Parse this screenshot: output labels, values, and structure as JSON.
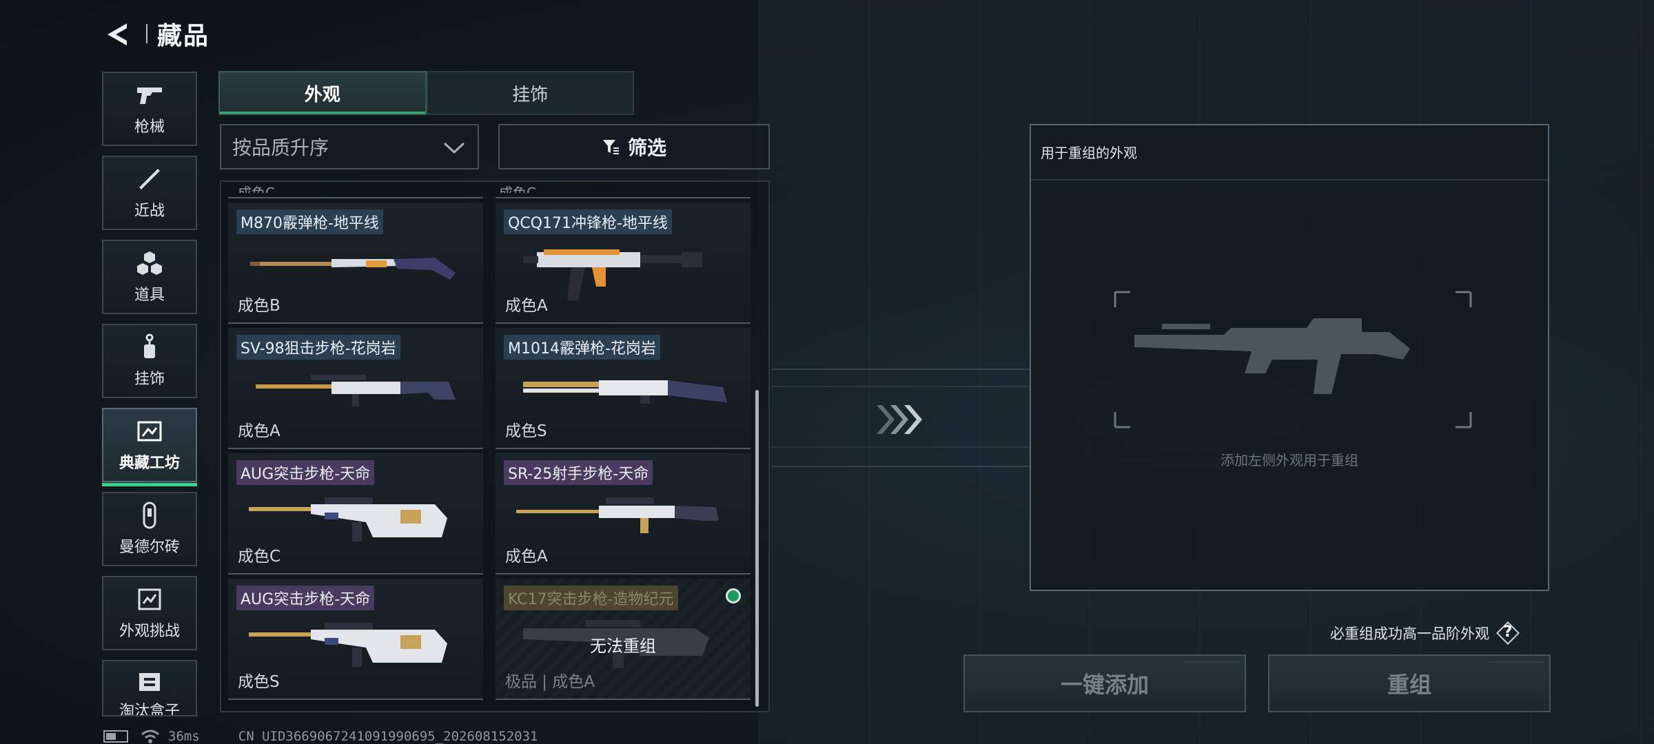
{
  "header": {
    "title": "藏品"
  },
  "nav": [
    {
      "label": "枪械",
      "icon": "pistol-icon"
    },
    {
      "label": "近战",
      "icon": "knife-icon"
    },
    {
      "label": "道具",
      "icon": "cubes-icon"
    },
    {
      "label": "挂饰",
      "icon": "charm-icon"
    },
    {
      "label": "典藏工坊",
      "icon": "workshop-icon",
      "active": true
    },
    {
      "label": "曼德尔砖",
      "icon": "brick-icon"
    },
    {
      "label": "外观挑战",
      "icon": "challenge-icon"
    },
    {
      "label": "淘汰盒子",
      "icon": "box-icon"
    }
  ],
  "tabs": [
    {
      "label": "外观",
      "active": true
    },
    {
      "label": "挂饰",
      "active": false
    }
  ],
  "sort": {
    "value": "按品质升序"
  },
  "filter": {
    "label": "筛选"
  },
  "cutoff_row": [
    "成色C",
    "成色C"
  ],
  "items": [
    {
      "name": "M870霰弹枪-地平线",
      "grade": "成色B",
      "tag": "blue"
    },
    {
      "name": "QCQ171冲锋枪-地平线",
      "grade": "成色A",
      "tag": "blue"
    },
    {
      "name": "SV-98狙击步枪-花岗岩",
      "grade": "成色A",
      "tag": "blue"
    },
    {
      "name": "M1014霰弹枪-花岗岩",
      "grade": "成色S",
      "tag": "blue"
    },
    {
      "name": "AUG突击步枪-天命",
      "grade": "成色C",
      "tag": "purple"
    },
    {
      "name": "SR-25射手步枪-天命",
      "grade": "成色A",
      "tag": "purple"
    },
    {
      "name": "AUG突击步枪-天命",
      "grade": "成色S",
      "tag": "purple"
    },
    {
      "name": "KC17突击步枪-造物纪元",
      "grade": "极品 | 成色A",
      "tag": "gold",
      "disabled": true,
      "overlay": "无法重组"
    }
  ],
  "panel": {
    "title": "用于重组的外观",
    "hint": "添加左侧外观用于重组"
  },
  "help": {
    "text": "必重组成功高一品阶外观",
    "icon": "question-icon"
  },
  "buttons": {
    "add_all": "一键添加",
    "regroup": "重组"
  },
  "status": {
    "ping": "36ms",
    "uid": "CN UID3669067241091990695_202608152031"
  },
  "colors": {
    "accent": "#39d28a",
    "background": "#131c23",
    "panel_border": "#59666f"
  }
}
